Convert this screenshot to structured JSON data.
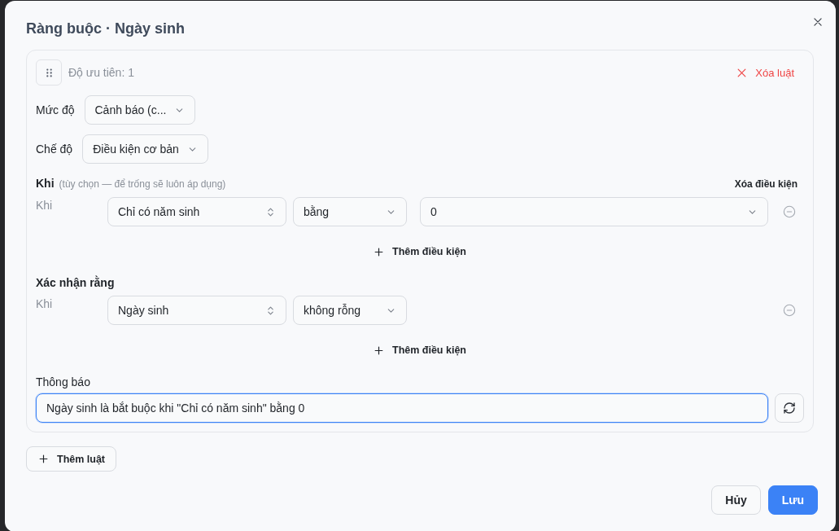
{
  "dialog": {
    "title": "Ràng buộc · Ngày sinh"
  },
  "rule": {
    "priority": "Độ ưu tiên: 1",
    "delete_label": "Xóa luật",
    "settings": [
      {
        "label": "Mức độ",
        "value": "Cảnh báo (c..."
      },
      {
        "label": "Chế độ",
        "value": "Điều kiện cơ bản"
      }
    ],
    "sections": [
      {
        "title": "Khi",
        "hint": "(tùy chọn — để trống sẽ luôn áp dụng)",
        "column_label": "Xóa điều kiện",
        "conditions": [
          {
            "prefix": "Khi",
            "field": "Chỉ có năm sinh",
            "operator": "bằng",
            "value": "0"
          }
        ],
        "add_label": "Thêm điều kiện"
      },
      {
        "title": "Xác nhận rằng",
        "conditions": [
          {
            "prefix": "Khi",
            "field": "Ngày sinh",
            "operator": "không rỗng"
          }
        ],
        "add_label": "Thêm điều kiện"
      }
    ],
    "message": {
      "label": "Thông báo",
      "value": "Ngày sinh là bắt buộc khi \"Chỉ có năm sinh\" bằng 0",
      "focused": true
    }
  },
  "add_rule_label": "Thêm luật",
  "footer_buttons": [
    {
      "label": "Hủy",
      "kind": "secondary"
    },
    {
      "label": "Lưu",
      "kind": "primary"
    }
  ]
}
